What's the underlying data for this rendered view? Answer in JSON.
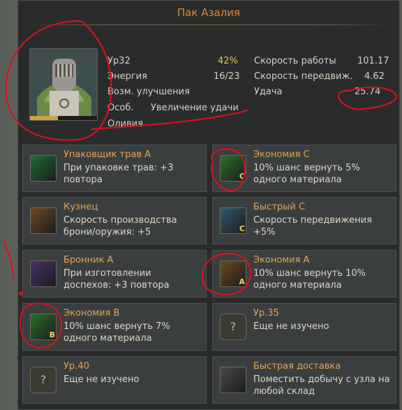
{
  "title": "Пак Азалия",
  "worker": {
    "level": "Ур32",
    "level_percent": "42%",
    "energy_label": "Энергия",
    "energy_value": "16/23",
    "upgrades_label": "Возм. улучшения",
    "special_label": "Особ.",
    "special_value": "Увеличение удачи",
    "name": "Оливия",
    "progress_fraction": 0.42,
    "work_speed_label": "Скорость работы",
    "work_speed_value": "101.17",
    "move_speed_label": "Скорость передвиж.",
    "move_speed_value": "4.62",
    "luck_label": "Удача",
    "luck_value": "25.74"
  },
  "skills": [
    {
      "name": "Упаковщик трав A",
      "desc": "При упаковке трав: +3 повтора",
      "icon": "herb-pack-icon",
      "color": "#1f6b3a"
    },
    {
      "name": "Экономия C",
      "desc": "10% шанс вернуть 5% одного материала",
      "icon": "economy-c-icon",
      "color": "#2c6e2c"
    },
    {
      "name": "Кузнец",
      "desc": "Скорость производства брони/оружия: +5",
      "icon": "blacksmith-icon",
      "color": "#6b4a2a"
    },
    {
      "name": "Быстрый C",
      "desc": "Скорость передвижения +5%",
      "icon": "fast-c-icon",
      "color": "#2f5a6a"
    },
    {
      "name": "Бронник A",
      "desc": "При изготовлении доспехов: +3 повтора",
      "icon": "armorer-icon",
      "color": "#4a2f6b"
    },
    {
      "name": "Экономия A",
      "desc": "10% шанс вернуть 10% одного материала",
      "icon": "economy-a-icon",
      "color": "#6b4a1f"
    },
    {
      "name": "Экономия B",
      "desc": "10% шанс вернуть 7% одного материала",
      "icon": "economy-b-icon",
      "color": "#2c6e2c"
    },
    {
      "name": "Ур.35",
      "desc": "Еще не изучено",
      "icon": "question-icon",
      "locked": true
    },
    {
      "name": "Ур.40",
      "desc": "Еще не изучено",
      "icon": "question-icon",
      "locked": true
    },
    {
      "name": "Быстрая доставка",
      "desc": "Поместить добычу с узла на любой склад",
      "icon": "fast-delivery-icon",
      "color": "#4a4a4a"
    }
  ],
  "locked_glyph": "?",
  "badges": {
    "economy_c": "C",
    "economy_a": "A",
    "economy_b": "B",
    "fast_c": "C"
  }
}
